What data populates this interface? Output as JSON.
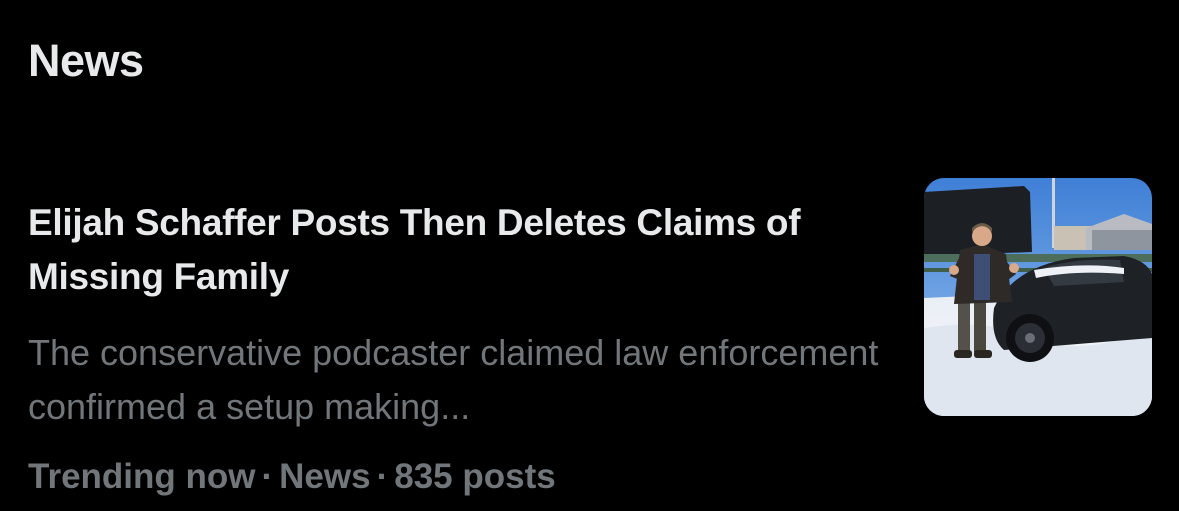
{
  "section": {
    "title": "News"
  },
  "story": {
    "headline": "Elijah Schaffer Posts Then Deletes Claims of Missing Family",
    "summary": "The conservative podcaster claimed law enforcement confirmed a setup making...",
    "meta": {
      "status": "Trending now",
      "category": "News",
      "posts": "835 posts",
      "separator": "·"
    },
    "thumbnail_icon": "news-photo-thumbnail"
  },
  "colors": {
    "background": "#000000",
    "primary_text": "#e7e9ea",
    "secondary_text": "#71767b"
  }
}
